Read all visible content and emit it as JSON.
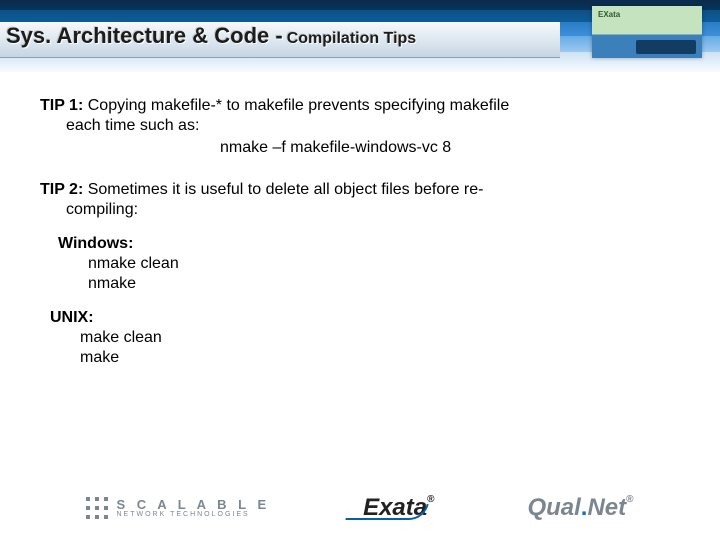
{
  "header": {
    "title_main": "Sys. Architecture & Code -",
    "title_sub": "Compilation Tips",
    "thumb_label": "EXata"
  },
  "tips": {
    "tip1": {
      "label": "TIP 1:",
      "line1": "  Copying makefile-* to makefile prevents specifying makefile",
      "line2": "each time such as:",
      "cmd": "nmake –f makefile-windows-vc 8"
    },
    "tip2": {
      "label": "TIP 2:",
      "line1": " Sometimes it is useful to delete all object files before re-",
      "line2": "compiling:"
    },
    "windows": {
      "title": "Windows:",
      "cmd1": "nmake clean",
      "cmd2": "nmake"
    },
    "unix": {
      "title": "UNIX:",
      "cmd1": "make clean",
      "cmd2": "make"
    }
  },
  "logos": {
    "snt_line1": "S C A L A B L E",
    "snt_line2": "NETWORK TECHNOLOGIES",
    "exata": "Exata",
    "qualnet_a": "Qual",
    "qualnet_b": "Net"
  }
}
